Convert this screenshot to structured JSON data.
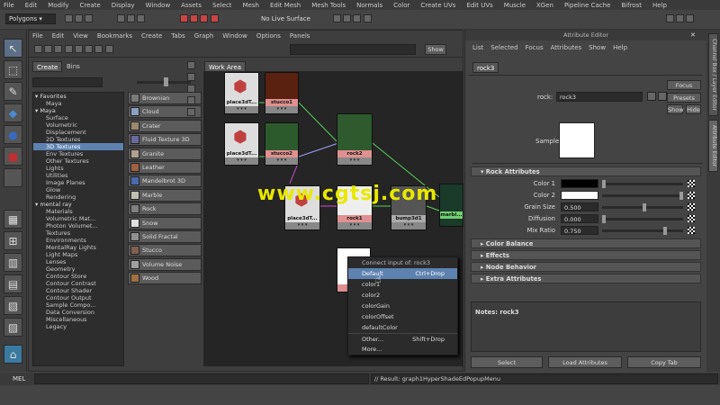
{
  "menubar": [
    "File",
    "Edit",
    "Modify",
    "Create",
    "Display",
    "Window",
    "Assets",
    "Select",
    "Mesh",
    "Edit Mesh",
    "Mesh Tools",
    "Normals",
    "Color",
    "Create UVs",
    "Edit UVs",
    "Muscle",
    "XGen",
    "Pipeline Cache",
    "Bifrost",
    "Help"
  ],
  "shelf": {
    "mode": "Polygons",
    "live_surface": "No Live Surface"
  },
  "hypershade": {
    "menu": [
      "File",
      "Edit",
      "View",
      "Bookmarks",
      "Create",
      "Tabs",
      "Graph",
      "Window",
      "Options",
      "Panels"
    ],
    "show_label": "Show",
    "tabs": {
      "create": "Create",
      "bins": "Bins",
      "work_area": "Work Area"
    },
    "tree": [
      {
        "label": "Favorites",
        "type": "h"
      },
      {
        "label": "Maya",
        "type": "c"
      },
      {
        "label": "Maya",
        "type": "h"
      },
      {
        "label": "Surface",
        "type": "c"
      },
      {
        "label": "Volumetric",
        "type": "c"
      },
      {
        "label": "Displacement",
        "type": "c"
      },
      {
        "label": "2D Textures",
        "type": "c"
      },
      {
        "label": "3D Textures",
        "type": "sel"
      },
      {
        "label": "Env Textures",
        "type": "c"
      },
      {
        "label": "Other Textures",
        "type": "c"
      },
      {
        "label": "Lights",
        "type": "c"
      },
      {
        "label": "Utilities",
        "type": "c"
      },
      {
        "label": "Image Planes",
        "type": "c"
      },
      {
        "label": "Glow",
        "type": "c"
      },
      {
        "label": "Rendering",
        "type": "c"
      },
      {
        "label": "mental ray",
        "type": "h"
      },
      {
        "label": "Materials",
        "type": "c"
      },
      {
        "label": "Volumetric Mat...",
        "type": "c"
      },
      {
        "label": "Photon Volumet...",
        "type": "c"
      },
      {
        "label": "Textures",
        "type": "c"
      },
      {
        "label": "Environments",
        "type": "c"
      },
      {
        "label": "MentalRay Lights",
        "type": "c"
      },
      {
        "label": "Light Maps",
        "type": "c"
      },
      {
        "label": "Lenses",
        "type": "c"
      },
      {
        "label": "Geometry",
        "type": "c"
      },
      {
        "label": "Contour Store",
        "type": "c"
      },
      {
        "label": "Contour Contrast",
        "type": "c"
      },
      {
        "label": "Contour Shader",
        "type": "c"
      },
      {
        "label": "Contour Output",
        "type": "c"
      },
      {
        "label": "Sample Compo...",
        "type": "c"
      },
      {
        "label": "Data Conversion",
        "type": "c"
      },
      {
        "label": "Miscellaneous",
        "type": "c"
      },
      {
        "label": "Legacy",
        "type": "c"
      }
    ],
    "items": [
      {
        "label": "Brownian",
        "color": "#7a7a7a"
      },
      {
        "label": "Cloud",
        "color": "#8aa0c0"
      },
      {
        "label": "Crater",
        "color": "#9a8a70"
      },
      {
        "label": "Fluid Texture 3D",
        "color": "#6a6aa0"
      },
      {
        "label": "Granite",
        "color": "#b0a090"
      },
      {
        "label": "Leather",
        "color": "#a06040"
      },
      {
        "label": "Mandelbrot 3D",
        "color": "#4a6ab0"
      },
      {
        "label": "Marble",
        "color": "#c0c0b0"
      },
      {
        "label": "Rock",
        "color": "#808080"
      },
      {
        "label": "Snow",
        "color": "#e0e0e0"
      },
      {
        "label": "Solid Fractal",
        "color": "#909090"
      },
      {
        "label": "Stucco",
        "color": "#806050"
      },
      {
        "label": "Volume Noise",
        "color": "#a0a0a0"
      },
      {
        "label": "Wood",
        "color": "#a07040"
      }
    ],
    "nodes": {
      "place3d1": "place3dT...",
      "stucco1": "stucco1",
      "place3d2": "place3dT...",
      "stucco2": "stucco2",
      "rock2": "rock2",
      "place3d3": "place3dT...",
      "rock1": "rock1",
      "bump3d1": "bump3d1",
      "marble": "marbl..."
    },
    "popup": {
      "header": "Connect input of: rock3",
      "items": [
        {
          "label": "Default",
          "shortcut": "Ctrl+Drop",
          "selected": true
        },
        {
          "label": "color1",
          "shortcut": ""
        },
        {
          "label": "color2",
          "shortcut": ""
        },
        {
          "label": "colorGain",
          "shortcut": ""
        },
        {
          "label": "colorOffset",
          "shortcut": ""
        },
        {
          "label": "defaultColor",
          "shortcut": ""
        },
        {
          "label": "Other...",
          "shortcut": "Shift+Drop"
        },
        {
          "label": "More...",
          "shortcut": ""
        }
      ]
    },
    "watermark": "www.cgtsj.com"
  },
  "attr_editor": {
    "title": "Attribute Editor",
    "menu": [
      "List",
      "Selected",
      "Focus",
      "Attributes",
      "Show",
      "Help"
    ],
    "tab": "rock3",
    "node_label": "rock:",
    "node_value": "rock3",
    "focus": "Focus",
    "presets": "Presets",
    "show": "Show",
    "hide": "Hide",
    "sample": "Sample",
    "section_rock": "Rock Attributes",
    "attrs": [
      {
        "label": "Color 1",
        "kind": "color",
        "color": "#000000"
      },
      {
        "label": "Color 2",
        "kind": "color",
        "color": "#ffffff"
      },
      {
        "label": "Grain Size",
        "kind": "num",
        "value": "0.500"
      },
      {
        "label": "Diffusion",
        "kind": "num",
        "value": "0.000"
      },
      {
        "label": "Mix Ratio",
        "kind": "num",
        "value": "0.750"
      }
    ],
    "sections": [
      "Color Balance",
      "Effects",
      "Node Behavior",
      "Extra Attributes"
    ],
    "notes": "Notes: rock3",
    "buttons": {
      "select": "Select",
      "load": "Load Attributes",
      "copy": "Copy Tab"
    }
  },
  "side_tabs": [
    "Channel Box / Layer Editor",
    "Attribute Editor"
  ],
  "bottom": {
    "mel": "MEL",
    "result": "// Result: graph1HyperShadeEdPopupMenu"
  }
}
